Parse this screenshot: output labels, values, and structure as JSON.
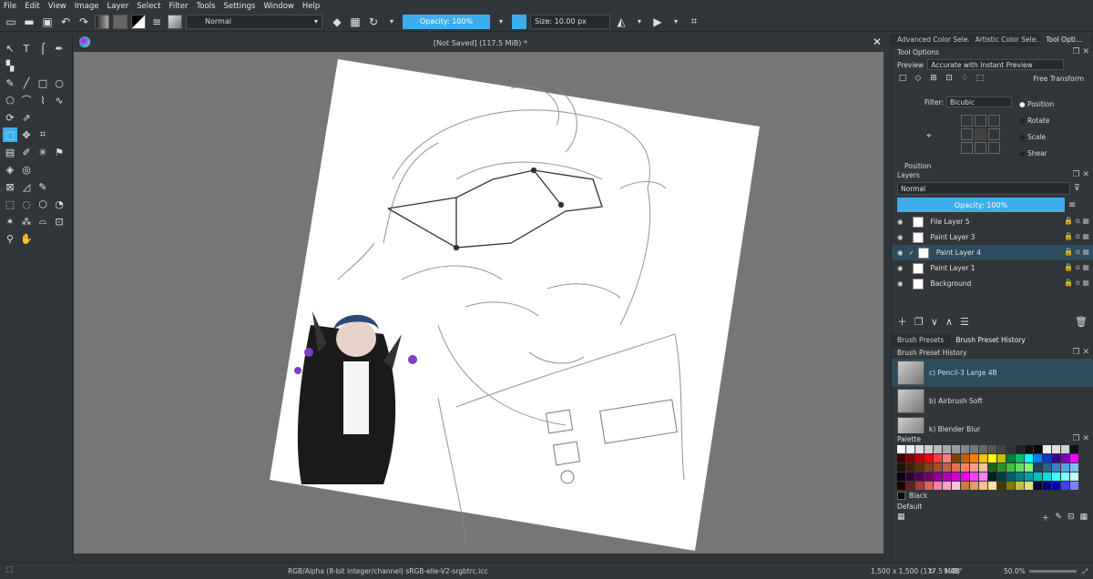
{
  "menu": [
    "File",
    "Edit",
    "View",
    "Image",
    "Layer",
    "Select",
    "Filter",
    "Tools",
    "Settings",
    "Window",
    "Help"
  ],
  "toolbar": {
    "blend_mode": "Normal",
    "opacity": "Opacity: 100%",
    "size": "Size: 10.00 px"
  },
  "document": {
    "title": "[Not Saved]  (117.5 MiB) *"
  },
  "docker_tabs": [
    "Advanced Color Sele...",
    "Artistic Color Sele...",
    "Tool Opti..."
  ],
  "tool_options": {
    "title": "Tool Options",
    "preview_label": "Preview",
    "preview_value": "Accurate with Instant Preview",
    "mode": "Free Transform",
    "filter_label": "Filter:",
    "filter_value": "Bicubic",
    "options": [
      "Position",
      "Rotate",
      "Scale",
      "Shear"
    ],
    "section": "Position"
  },
  "layers": {
    "title": "Layers",
    "blend_mode": "Normal",
    "opacity": "Opacity: 100%",
    "items": [
      {
        "name": "File Layer 5",
        "selected": false
      },
      {
        "name": "Paint Layer 3",
        "selected": false
      },
      {
        "name": "Paint Layer 4",
        "selected": true
      },
      {
        "name": "Paint Layer 1",
        "selected": false
      },
      {
        "name": "Background",
        "selected": false
      }
    ]
  },
  "brush_tabs": [
    "Brush Presets",
    "Brush Preset History"
  ],
  "brush_history": {
    "title": "Brush Preset History",
    "items": [
      "c) Pencil-3 Large 4B",
      "b) Airbrush Soft",
      "k) Blender Blur"
    ]
  },
  "palette": {
    "title": "Palette",
    "current_color": "Black",
    "set_name": "Default"
  },
  "status": {
    "color_space": "RGB/Alpha (8-bit integer/channel)  sRGB-elle-V2-srgbtrc.icc",
    "dimensions": "1,500 x 1,500 (117.5 MiB)",
    "rotation": "9.48°",
    "zoom": "50.0%"
  },
  "colors": {
    "accent": "#3daee9",
    "background": "#31363b",
    "canvas_bg": "#767676",
    "selected_row": "#2d4c5e"
  }
}
